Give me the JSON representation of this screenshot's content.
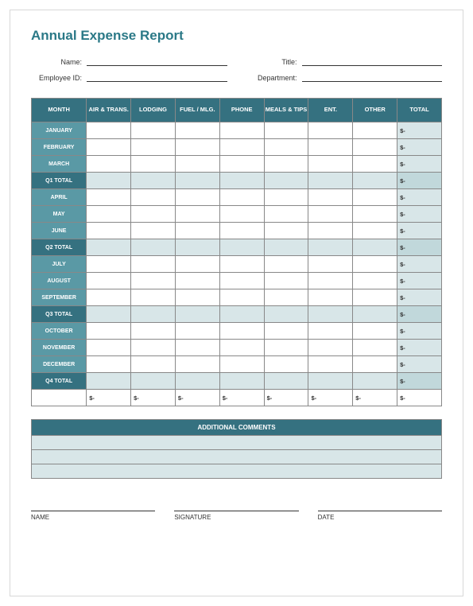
{
  "title": "Annual Expense Report",
  "header": {
    "name_label": "Name:",
    "name_value": "",
    "title_label": "Title:",
    "title_value": "",
    "employee_id_label": "Employee ID:",
    "employee_id_value": "",
    "department_label": "Department:",
    "department_value": ""
  },
  "columns": {
    "month": "MONTH",
    "air": "AIR & TRANS.",
    "lodging": "LODGING",
    "fuel": "FUEL / MLG.",
    "phone": "PHONE",
    "meals": "MEALS & TIPS",
    "ent": "ENT.",
    "other": "OTHER",
    "total": "TOTAL"
  },
  "chart_data": {
    "type": "table",
    "categories": [
      "AIR & TRANS.",
      "LODGING",
      "FUEL / MLG.",
      "PHONE",
      "MEALS & TIPS",
      "ENT.",
      "OTHER"
    ],
    "rows": [
      {
        "label": "JANUARY",
        "kind": "month",
        "values": [
          "",
          "",
          "",
          "",
          "",
          "",
          ""
        ],
        "total": "$-"
      },
      {
        "label": "FEBRUARY",
        "kind": "month",
        "values": [
          "",
          "",
          "",
          "",
          "",
          "",
          ""
        ],
        "total": "$-"
      },
      {
        "label": "MARCH",
        "kind": "month",
        "values": [
          "",
          "",
          "",
          "",
          "",
          "",
          ""
        ],
        "total": "$-"
      },
      {
        "label": "Q1 TOTAL",
        "kind": "qt",
        "values": [
          "",
          "",
          "",
          "",
          "",
          "",
          ""
        ],
        "total": "$-"
      },
      {
        "label": "APRIL",
        "kind": "month",
        "values": [
          "",
          "",
          "",
          "",
          "",
          "",
          ""
        ],
        "total": "$-"
      },
      {
        "label": "MAY",
        "kind": "month",
        "values": [
          "",
          "",
          "",
          "",
          "",
          "",
          ""
        ],
        "total": "$-"
      },
      {
        "label": "JUNE",
        "kind": "month",
        "values": [
          "",
          "",
          "",
          "",
          "",
          "",
          ""
        ],
        "total": "$-"
      },
      {
        "label": "Q2 TOTAL",
        "kind": "qt",
        "values": [
          "",
          "",
          "",
          "",
          "",
          "",
          ""
        ],
        "total": "$-"
      },
      {
        "label": "JULY",
        "kind": "month",
        "values": [
          "",
          "",
          "",
          "",
          "",
          "",
          ""
        ],
        "total": "$-"
      },
      {
        "label": "AUGUST",
        "kind": "month",
        "values": [
          "",
          "",
          "",
          "",
          "",
          "",
          ""
        ],
        "total": "$-"
      },
      {
        "label": "SEPTEMBER",
        "kind": "month",
        "values": [
          "",
          "",
          "",
          "",
          "",
          "",
          ""
        ],
        "total": "$-"
      },
      {
        "label": "Q3 TOTAL",
        "kind": "qt",
        "values": [
          "",
          "",
          "",
          "",
          "",
          "",
          ""
        ],
        "total": "$-"
      },
      {
        "label": "OCTOBER",
        "kind": "month",
        "values": [
          "",
          "",
          "",
          "",
          "",
          "",
          ""
        ],
        "total": "$-"
      },
      {
        "label": "NOVEMBER",
        "kind": "month",
        "values": [
          "",
          "",
          "",
          "",
          "",
          "",
          ""
        ],
        "total": "$-"
      },
      {
        "label": "DECEMBER",
        "kind": "month",
        "values": [
          "",
          "",
          "",
          "",
          "",
          "",
          ""
        ],
        "total": "$-"
      },
      {
        "label": "Q4 TOTAL",
        "kind": "qt",
        "values": [
          "",
          "",
          "",
          "",
          "",
          "",
          ""
        ],
        "total": "$-"
      },
      {
        "label": "",
        "kind": "grand",
        "values": [
          "$-",
          "$-",
          "$-",
          "$-",
          "$-",
          "$-",
          "$-"
        ],
        "total": "$-"
      }
    ]
  },
  "comments": {
    "header": "ADDITIONAL COMMENTS",
    "rows": [
      "",
      "",
      ""
    ]
  },
  "signatures": {
    "name": "NAME",
    "signature": "SIGNATURE",
    "date": "DATE"
  }
}
